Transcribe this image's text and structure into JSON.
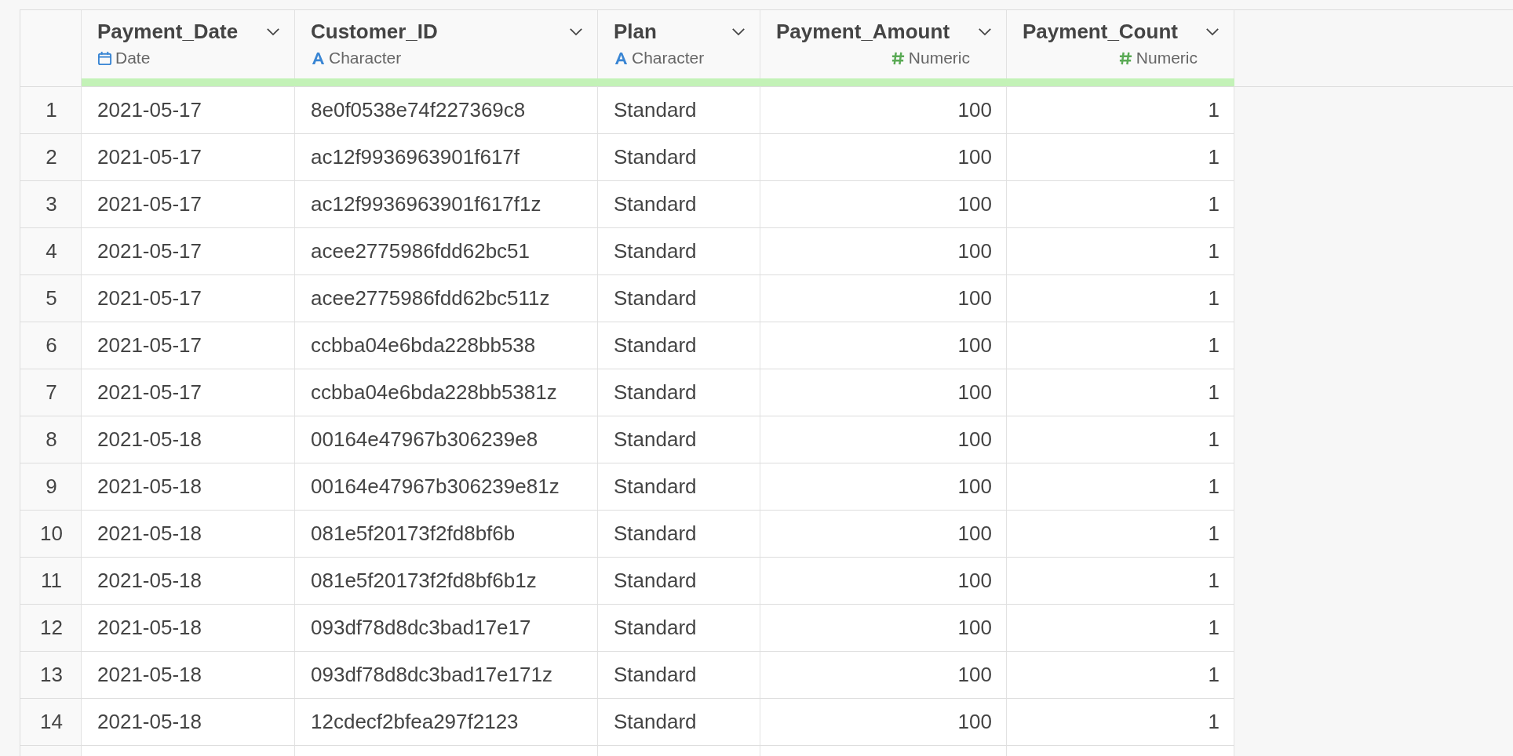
{
  "table": {
    "columns": [
      {
        "name": "Payment_Date",
        "type": "Date",
        "kind": "date"
      },
      {
        "name": "Customer_ID",
        "type": "Character",
        "kind": "character"
      },
      {
        "name": "Plan",
        "type": "Character",
        "kind": "character"
      },
      {
        "name": "Payment_Amount",
        "type": "Numeric",
        "kind": "numeric"
      },
      {
        "name": "Payment_Count",
        "type": "Numeric",
        "kind": "numeric"
      }
    ],
    "rows": [
      {
        "index": "1",
        "cells": [
          "2021-05-17",
          "8e0f0538e74f227369c8",
          "Standard",
          "100",
          "1"
        ]
      },
      {
        "index": "2",
        "cells": [
          "2021-05-17",
          "ac12f9936963901f617f",
          "Standard",
          "100",
          "1"
        ]
      },
      {
        "index": "3",
        "cells": [
          "2021-05-17",
          "ac12f9936963901f617f1z",
          "Standard",
          "100",
          "1"
        ]
      },
      {
        "index": "4",
        "cells": [
          "2021-05-17",
          "acee2775986fdd62bc51",
          "Standard",
          "100",
          "1"
        ]
      },
      {
        "index": "5",
        "cells": [
          "2021-05-17",
          "acee2775986fdd62bc511z",
          "Standard",
          "100",
          "1"
        ]
      },
      {
        "index": "6",
        "cells": [
          "2021-05-17",
          "ccbba04e6bda228bb538",
          "Standard",
          "100",
          "1"
        ]
      },
      {
        "index": "7",
        "cells": [
          "2021-05-17",
          "ccbba04e6bda228bb5381z",
          "Standard",
          "100",
          "1"
        ]
      },
      {
        "index": "8",
        "cells": [
          "2021-05-18",
          "00164e47967b306239e8",
          "Standard",
          "100",
          "1"
        ]
      },
      {
        "index": "9",
        "cells": [
          "2021-05-18",
          "00164e47967b306239e81z",
          "Standard",
          "100",
          "1"
        ]
      },
      {
        "index": "10",
        "cells": [
          "2021-05-18",
          "081e5f20173f2fd8bf6b",
          "Standard",
          "100",
          "1"
        ]
      },
      {
        "index": "11",
        "cells": [
          "2021-05-18",
          "081e5f20173f2fd8bf6b1z",
          "Standard",
          "100",
          "1"
        ]
      },
      {
        "index": "12",
        "cells": [
          "2021-05-18",
          "093df78d8dc3bad17e17",
          "Standard",
          "100",
          "1"
        ]
      },
      {
        "index": "13",
        "cells": [
          "2021-05-18",
          "093df78d8dc3bad17e171z",
          "Standard",
          "100",
          "1"
        ]
      },
      {
        "index": "14",
        "cells": [
          "2021-05-18",
          "12cdecf2bfea297f2123",
          "Standard",
          "100",
          "1"
        ]
      }
    ]
  }
}
